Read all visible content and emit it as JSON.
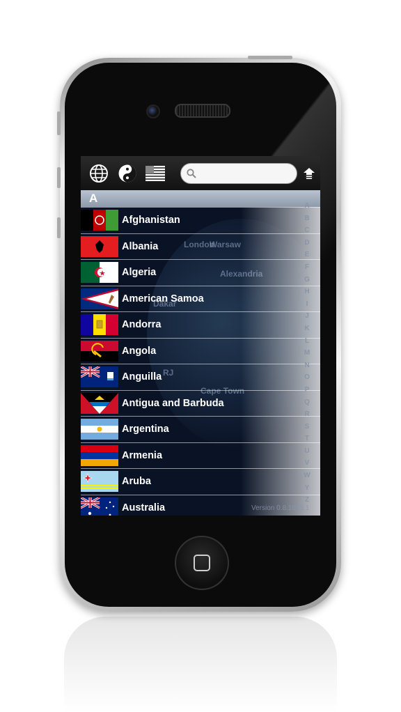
{
  "toolbar": {
    "icons": [
      "globe-icon",
      "yin-yang-icon",
      "us-flag-icon",
      "home-icon"
    ],
    "search_placeholder": ""
  },
  "section": {
    "letter": "A"
  },
  "countries": [
    {
      "name": "Afghanistan"
    },
    {
      "name": "Albania"
    },
    {
      "name": "Algeria"
    },
    {
      "name": "American Samoa"
    },
    {
      "name": "Andorra"
    },
    {
      "name": "Angola"
    },
    {
      "name": "Anguilla"
    },
    {
      "name": "Antigua and Barbuda"
    },
    {
      "name": "Argentina"
    },
    {
      "name": "Armenia"
    },
    {
      "name": "Aruba"
    },
    {
      "name": "Australia"
    }
  ],
  "index_letters": [
    "A",
    "B",
    "C",
    "D",
    "E",
    "F",
    "G",
    "H",
    "I",
    "J",
    "K",
    "L",
    "M",
    "N",
    "O",
    "P",
    "Q",
    "R",
    "S",
    "T",
    "U",
    "V",
    "W",
    "Y",
    "Z"
  ],
  "map_labels": [
    "London",
    "Warsaw",
    "Alexandria",
    "Dakar",
    "Cape Town",
    "RJ"
  ],
  "version": "Version 0.8.1015.1"
}
